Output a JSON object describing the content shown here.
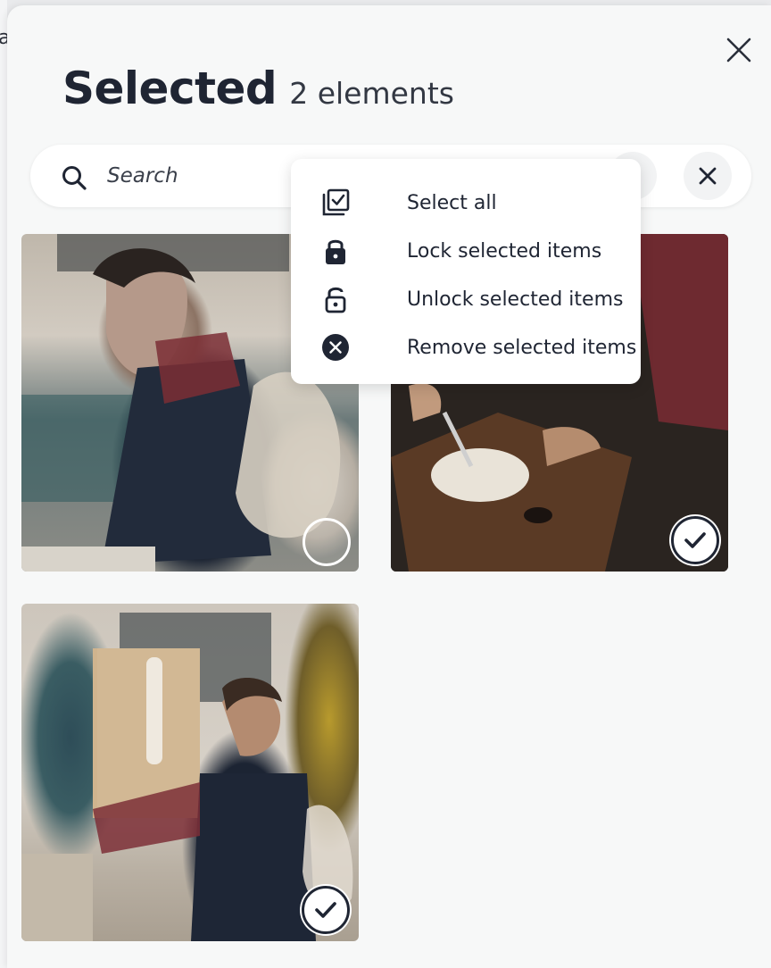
{
  "backdrop": {
    "edge_text": "a"
  },
  "panel": {
    "title": "Selected",
    "count_label": "2 elements"
  },
  "search": {
    "placeholder": "Search",
    "value": ""
  },
  "menu": {
    "items": [
      {
        "label": "Select all",
        "icon": "select-all-icon"
      },
      {
        "label": "Lock selected items",
        "icon": "lock-icon"
      },
      {
        "label": "Unlock selected items",
        "icon": "unlock-icon"
      },
      {
        "label": "Remove selected items",
        "icon": "remove-circle-icon"
      }
    ]
  },
  "items": [
    {
      "selected": false
    },
    {
      "selected": true
    },
    {
      "selected": true
    }
  ],
  "colors": {
    "accent": "#1f2533",
    "panel_bg": "#f7f8f8",
    "menu_bg": "#ffffff"
  }
}
